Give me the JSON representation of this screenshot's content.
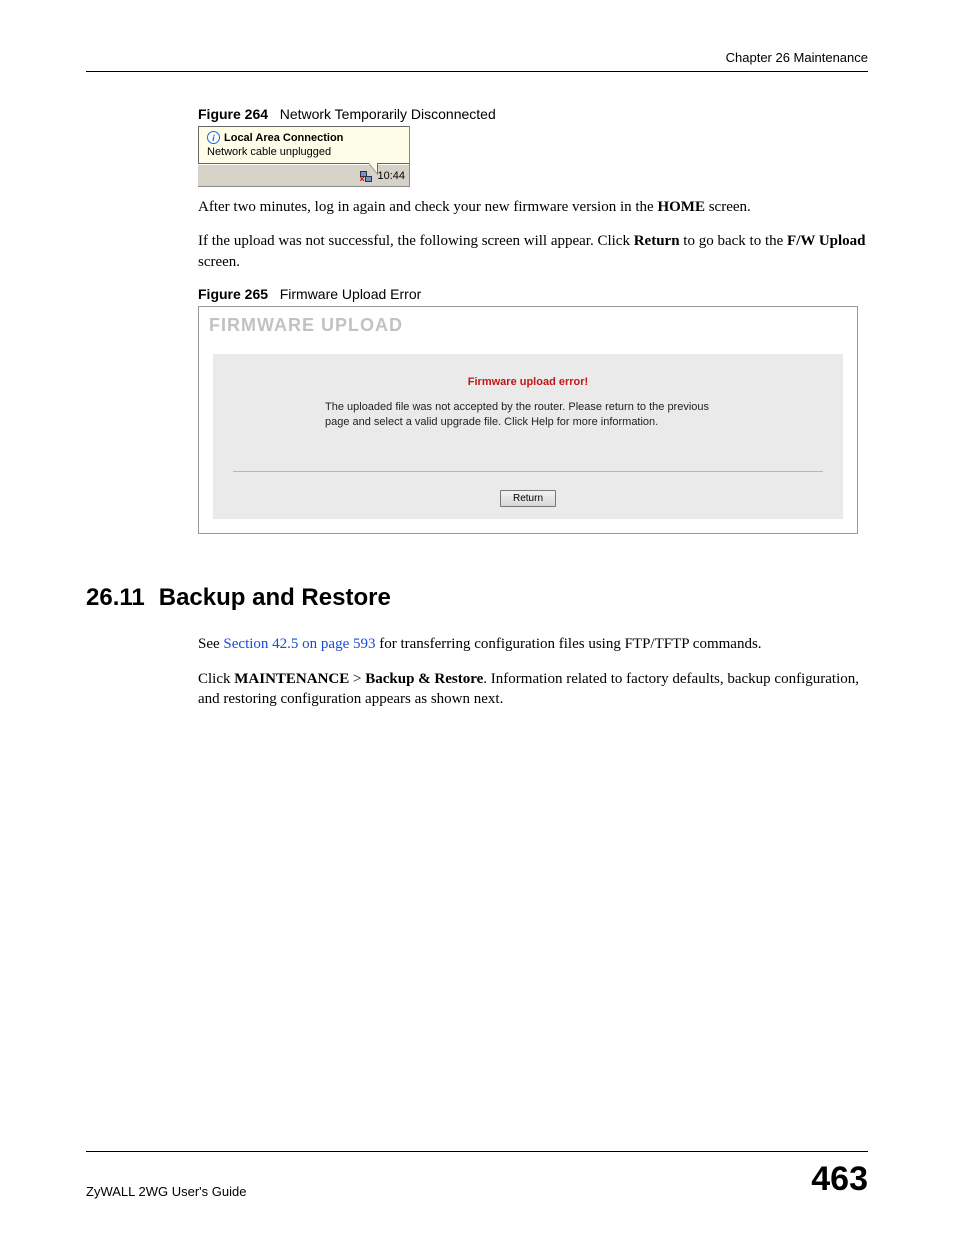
{
  "header": {
    "chapter": "Chapter 26 Maintenance"
  },
  "figure264": {
    "caption_num": "Figure 264",
    "caption_text": "Network Temporarily Disconnected",
    "balloon_title": "Local Area Connection",
    "balloon_msg": "Network cable unplugged",
    "tray_time": "10:44"
  },
  "para1": {
    "pre": "After two minutes, log in again and check your new firmware version in the ",
    "bold1": "HOME",
    "post": " screen."
  },
  "para2": {
    "pre": "If the upload was not successful, the following screen will appear. Click ",
    "bold1": "Return",
    "mid": " to go back to the ",
    "bold2": "F/W Upload",
    "post": " screen."
  },
  "figure265": {
    "caption_num": "Figure 265",
    "caption_text": "Firmware Upload Error",
    "panel_title": "FIRMWARE UPLOAD",
    "error_title": "Firmware upload error!",
    "error_msg": "The uploaded file was not accepted by the router. Please return to the previous page and select a valid upgrade file. Click Help for more information.",
    "return_label": "Return"
  },
  "section": {
    "number": "26.11",
    "title": "Backup and Restore",
    "p1_pre": "See ",
    "p1_link": "Section 42.5 on page 593",
    "p1_post": " for transferring configuration files using FTP/TFTP commands.",
    "p2_pre": "Click ",
    "p2_b1": "MAINTENANCE",
    "p2_gt": " > ",
    "p2_b2": "Backup & Restore",
    "p2_post": ". Information related to factory defaults, backup configuration, and restoring configuration appears as shown next."
  },
  "footer": {
    "left": "ZyWALL 2WG User's Guide",
    "right": "463"
  }
}
